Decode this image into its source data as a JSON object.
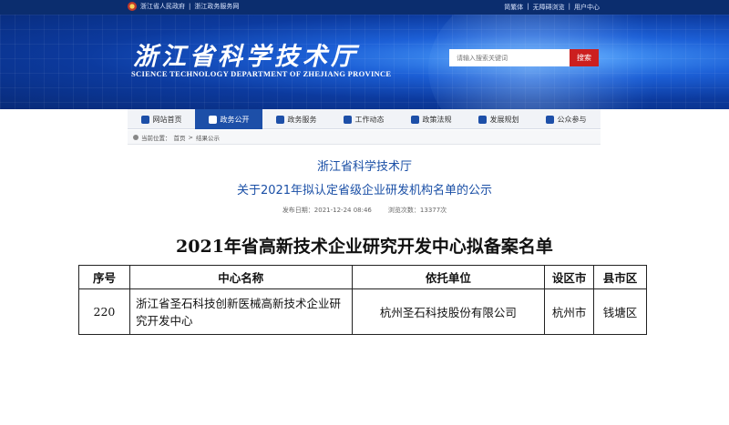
{
  "topbar": {
    "links_left": [
      "浙江省人民政府",
      "浙江政务服务网"
    ],
    "links_right": [
      "简繁体",
      "无障碍浏览",
      "用户中心"
    ]
  },
  "banner": {
    "title_cn": "浙江省科学技术厅",
    "title_en": "SCIENCE TECHNOLOGY DEPARTMENT OF ZHEJIANG PROVINCE",
    "search_placeholder": "请输入搜索关键词",
    "search_button": "搜索"
  },
  "nav": {
    "items": [
      {
        "label": "网站首页",
        "icon": "home-icon"
      },
      {
        "label": "政务公开",
        "icon": "folder-icon",
        "active": true
      },
      {
        "label": "政务服务",
        "icon": "service-icon"
      },
      {
        "label": "工作动态",
        "icon": "heart-icon"
      },
      {
        "label": "政策法规",
        "icon": "document-icon"
      },
      {
        "label": "发展规划",
        "icon": "handshake-icon"
      },
      {
        "label": "公众参与",
        "icon": "people-icon"
      }
    ]
  },
  "breadcrumb": {
    "prefix": "当前位置：",
    "items": [
      "首页",
      "结果公示"
    ]
  },
  "article": {
    "org": "浙江省科学技术厅",
    "title": "关于2021年拟认定省级企业研发机构名单的公示",
    "publish_date": "发布日期：2021-12-24 08:46",
    "views": "浏览次数：13377次"
  },
  "list": {
    "title": "2021年省高新技术企业研究开发中心拟备案名单",
    "headers": [
      "序号",
      "中心名称",
      "依托单位",
      "设区市",
      "县市区"
    ],
    "rows": [
      [
        "220",
        "浙江省圣石科技创新医械高新技术企业研究开发中心",
        "杭州圣石科技股份有限公司",
        "杭州市",
        "钱塘区"
      ]
    ]
  },
  "colors": {
    "brand_blue": "#1d4fa8",
    "search_red": "#cc1f1f",
    "title_blue": "#1a4fa6"
  }
}
